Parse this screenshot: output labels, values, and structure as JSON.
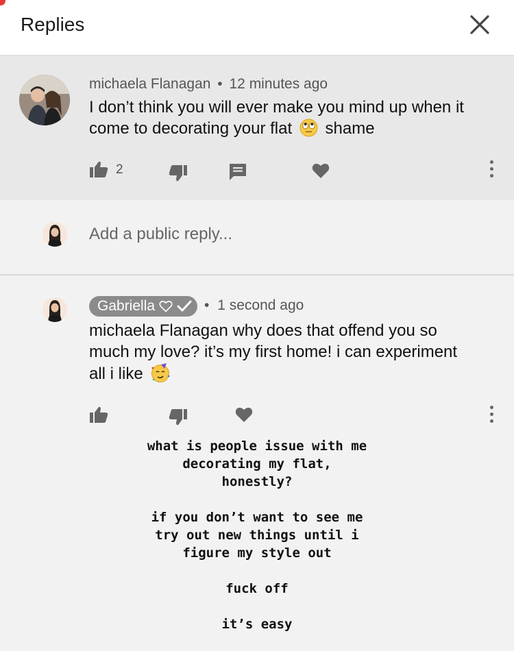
{
  "header": {
    "title": "Replies",
    "close_icon": "close-icon"
  },
  "parent_comment": {
    "author": "michaela Flanagan",
    "separator": "•",
    "time": "12 minutes ago",
    "text_line1": "I don’t think you will ever make you mind up when it",
    "text_line2_before_emoji": "come to decorating your flat",
    "emoji": "face-with-rolling-eyes",
    "text_line2_after_emoji": "shame",
    "like_count": "2",
    "icons": [
      "thumbs-up-icon",
      "thumbs-down-icon",
      "reply-icon",
      "heart-icon",
      "more-icon"
    ]
  },
  "reply_box": {
    "placeholder": "Add a public reply..."
  },
  "reply_comment": {
    "author": "Gabriella",
    "author_badges": [
      "heart-outline-icon",
      "checkmark-icon"
    ],
    "separator": "•",
    "time": "1 second ago",
    "text_line1": "michaela Flanagan why does that offend you so",
    "text_line2": "much my love? it’s my first home! i can experiment",
    "text_line3": "all i like",
    "emoji": "partying-face",
    "icons": [
      "thumbs-up-icon",
      "thumbs-down-icon",
      "heart-icon",
      "more-icon"
    ]
  },
  "caption": {
    "p1_line1": "what is people issue with me",
    "p1_line2": "decorating my flat,",
    "p1_line3": "honestly?",
    "p2_line1": "if you don’t want to see me",
    "p2_line2": "try out new things until i",
    "p2_line3": "figure my style out",
    "p3": "fuck off",
    "p4": "it’s easy"
  },
  "colors": {
    "header_bg": "#ffffff",
    "parent_bg": "#e8e8e8",
    "page_bg": "#f2f2f2",
    "author_chip_bg": "#8b8b8b",
    "icon_gray": "#666666",
    "notification_red": "#e53935"
  }
}
